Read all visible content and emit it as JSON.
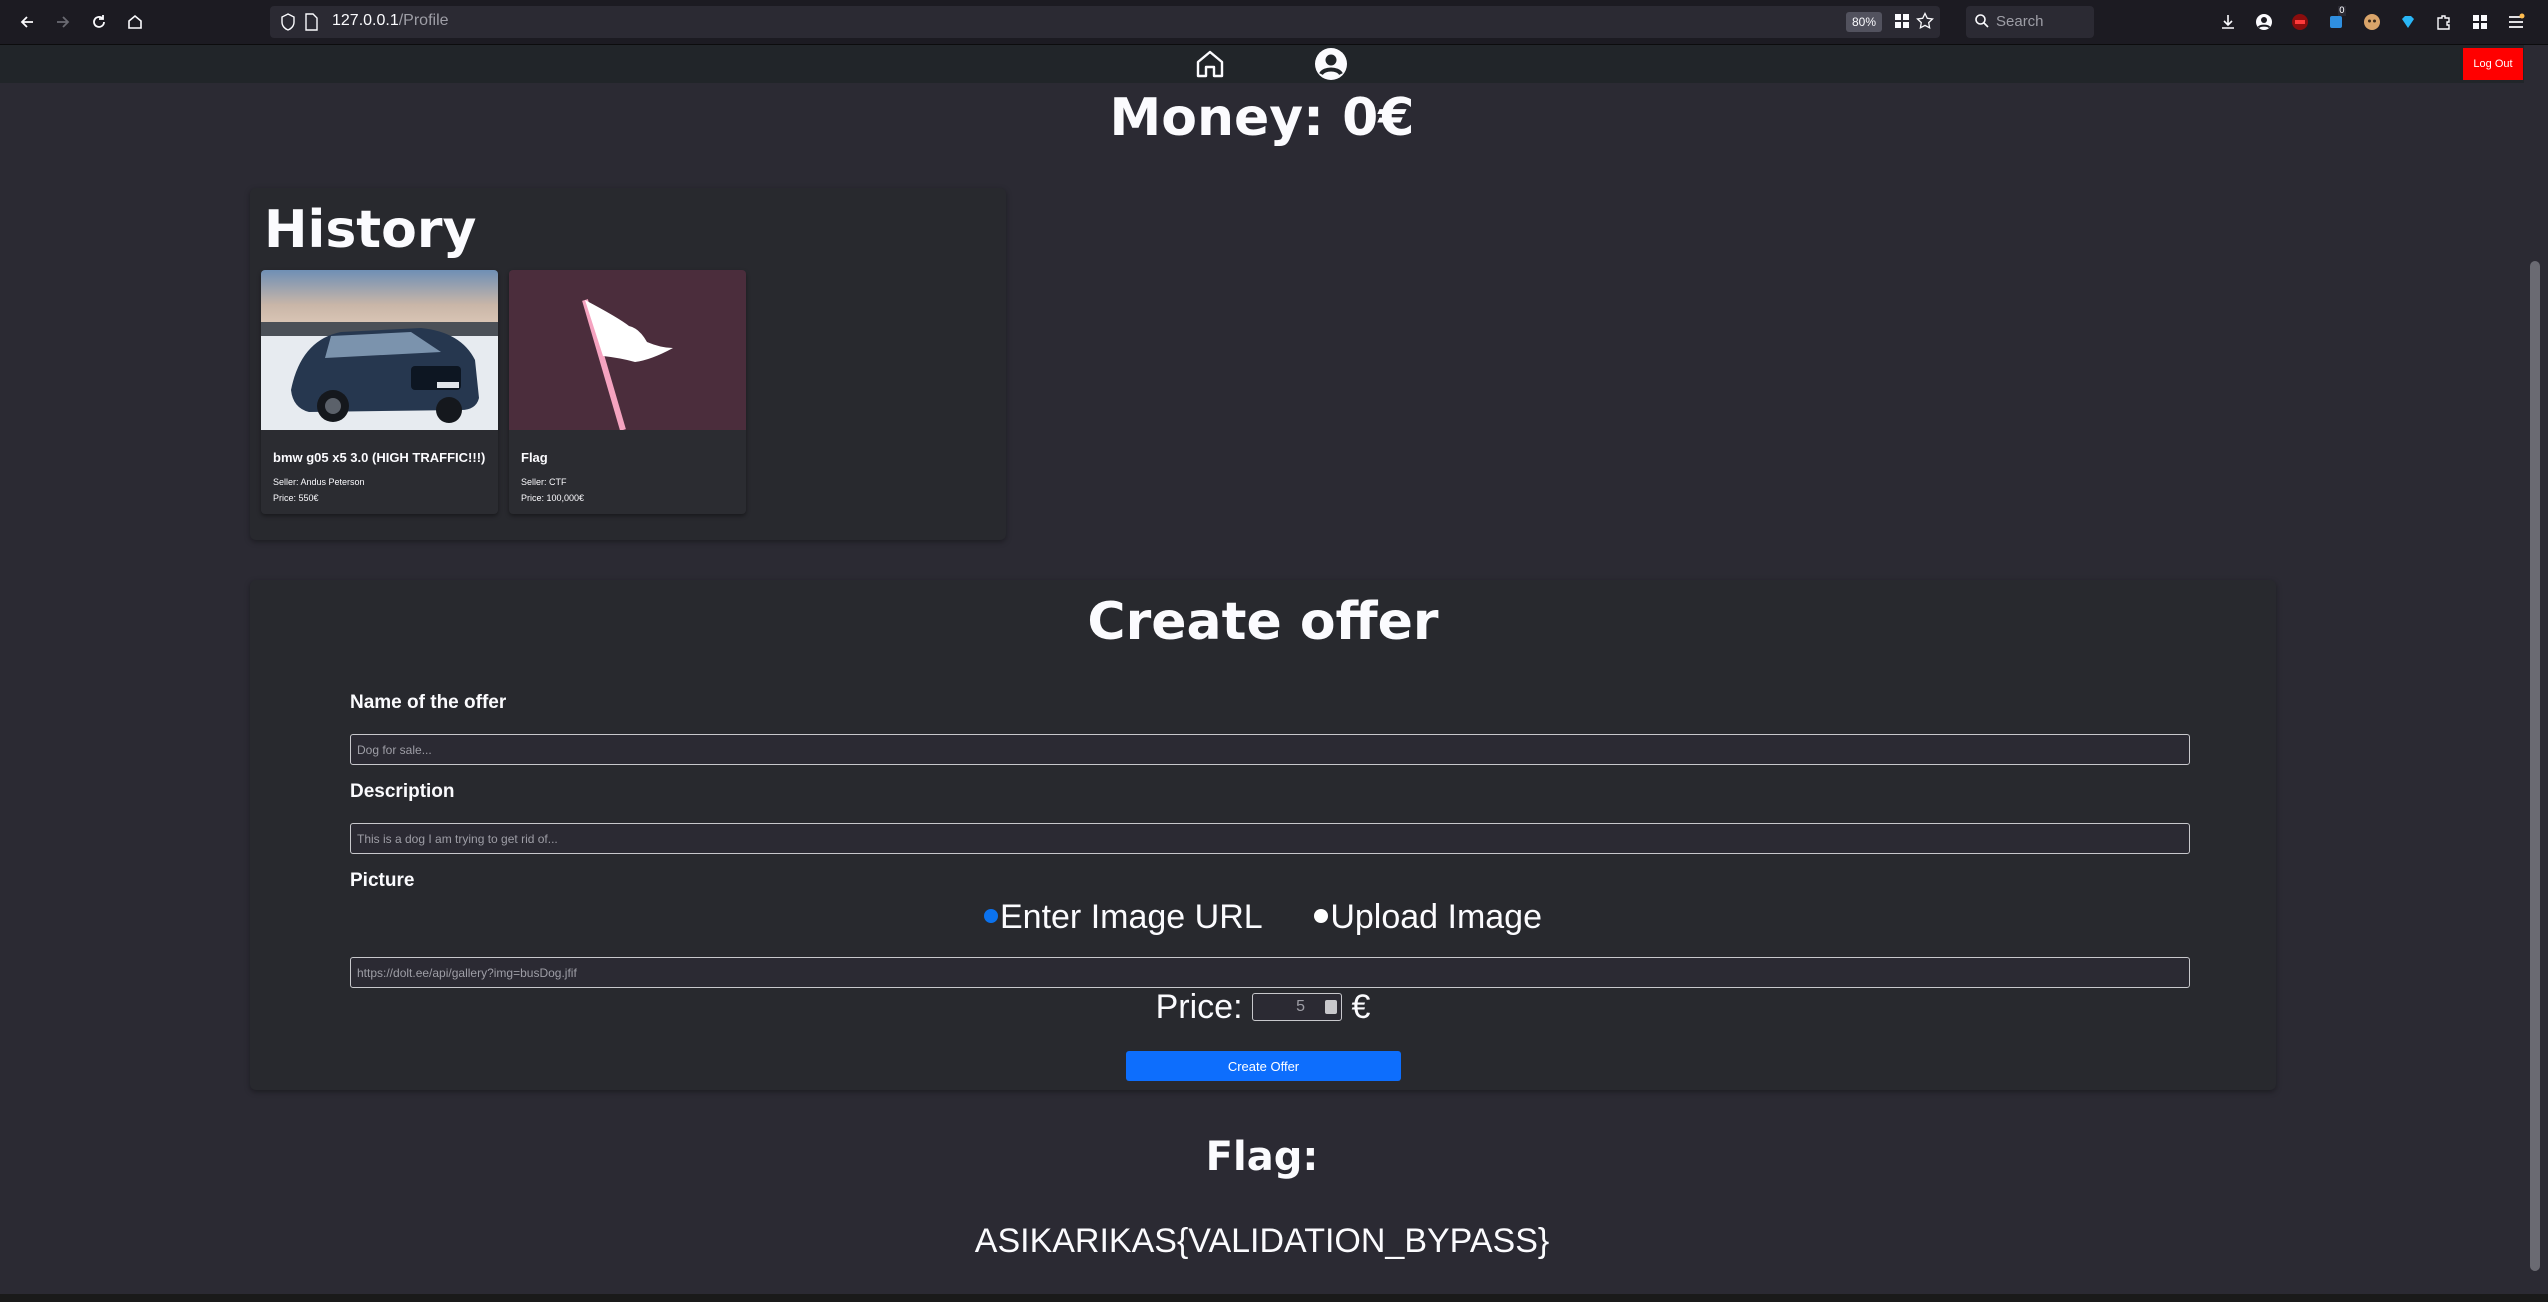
{
  "browser": {
    "url_host": "127.0.0.1",
    "url_path": "/Profile",
    "zoom": "80%",
    "search_placeholder": "Search",
    "extension_badge": "0"
  },
  "navbar": {
    "logout_label": "Log Out",
    "logout_color": "#ff0000"
  },
  "profile": {
    "money": "Money: 0€"
  },
  "history": {
    "title": "History",
    "items": [
      {
        "name": "bmw g05 x5 3.0 (HIGH TRAFFIC!!!)",
        "seller": "Seller: Andus Peterson",
        "price": "Price: 550€",
        "image": "car-photo"
      },
      {
        "name": "Flag",
        "seller": "Seller: CTF",
        "price": "Price: 100,000€",
        "image": "flag-icon"
      }
    ]
  },
  "create_offer": {
    "title": "Create offer",
    "name_label": "Name of the offer",
    "name_placeholder": "Dog for sale...",
    "description_label": "Description",
    "description_placeholder": "This is a dog I am trying to get rid of...",
    "picture_label": "Picture",
    "radio_url_label": "Enter Image URL",
    "radio_upload_label": "Upload Image",
    "image_url_placeholder": "https://dolt.ee/api/gallery?img=busDog.jfif",
    "price_label": "Price:",
    "price_value": "5",
    "currency": "€",
    "submit_label": "Create Offer",
    "submit_color": "#0d6efd"
  },
  "flag": {
    "title": "Flag:",
    "value": "ASIKARIKAS{VALIDATION_BYPASS}"
  }
}
